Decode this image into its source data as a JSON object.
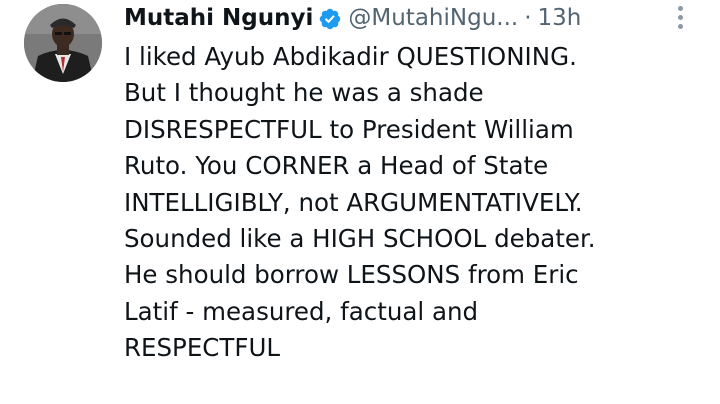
{
  "tweet": {
    "author": {
      "display_name": "Mutahi Ngunyi",
      "handle": "@MutahiNgu...",
      "verified_icon": "verified-badge-icon",
      "avatar_icon": "avatar"
    },
    "separator": "·",
    "time": "13h",
    "more_icon": "more-options-icon",
    "text_lines": [
      "I liked Ayub Abdikadir QUESTIONING.",
      "But I thought he was a shade",
      "DISRESPECTFUL to President William",
      "Ruto. You CORNER a Head of State",
      "INTELLIGIBLY, not ARGUMENTATIVELY.",
      "Sounded like a HIGH SCHOOL debater.",
      "He should borrow LESSONS from Eric",
      "Latif - measured, factual and",
      "RESPECTFUL"
    ]
  },
  "colors": {
    "text": "#0f1419",
    "secondary": "#536471",
    "verified": "#1d9bf0",
    "more_dots": "#8b98a5"
  }
}
